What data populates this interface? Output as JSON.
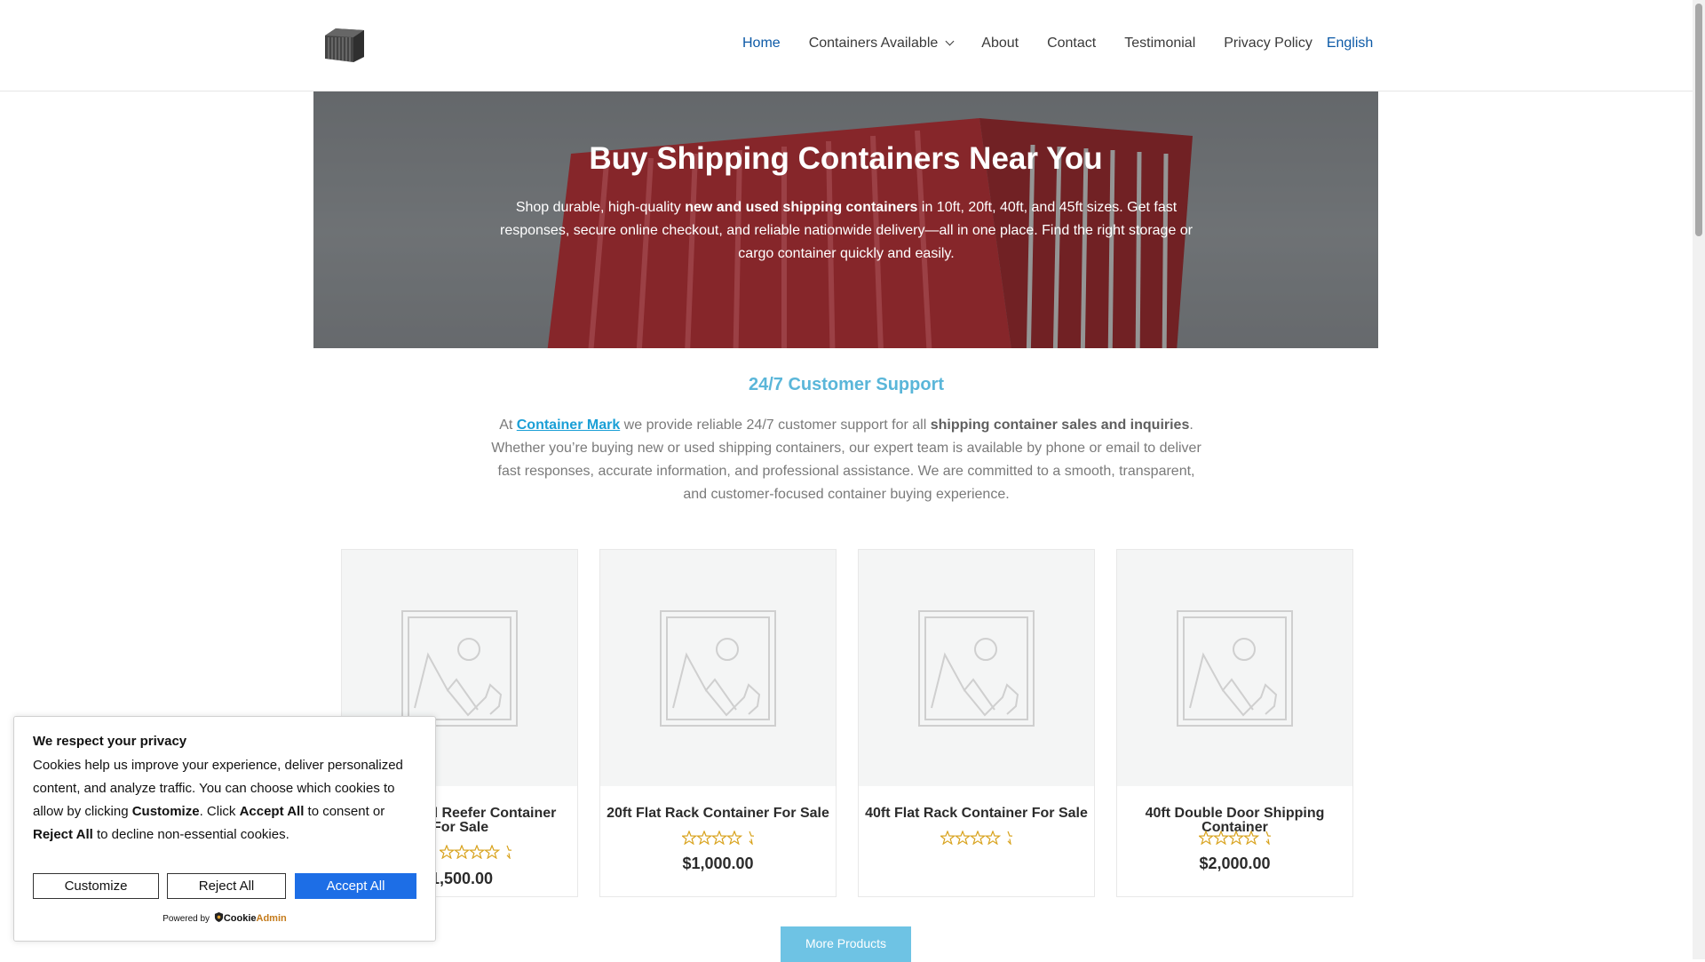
{
  "header": {
    "nav": [
      {
        "label": "Home"
      },
      {
        "label": "Containers Available"
      },
      {
        "label": "About"
      },
      {
        "label": "Contact"
      },
      {
        "label": "Testimonial"
      },
      {
        "label": "Privacy Policy"
      }
    ],
    "language": "English",
    "colors": {
      "active": "#0d5aa7"
    }
  },
  "hero": {
    "title": "Buy Shipping Containers Near You",
    "text_before": "Shop durable, high-quality ",
    "text_bold": "new and used shipping containers",
    "text_after": " in 10ft, 20ft, 40ft, and 45ft sizes. Get fast responses, secure online checkout, and reliable nationwide delivery—all in one place. Find the right storage or cargo container quickly and easily."
  },
  "support": {
    "title": "24/7 Customer Support",
    "pre": "At ",
    "link": "Container Mark",
    "mid": " we provide reliable 24/7 customer support for all ",
    "bold": "shipping container sales and inquiries",
    "post": ". Whether you’re buying new or used shipping containers, our expert team is available by phone or email to deliver fast responses, accurate information, and professional assistance. We are committed to a smooth, transparent, and customer-focused container buying experience.",
    "colors": {
      "title": "#5ab6d9",
      "link": "#1a9fd6"
    }
  },
  "products": [
    {
      "name": "ted Reefer Container",
      "name2": "For Sale",
      "price": "1,500.00",
      "rating": 4.5
    },
    {
      "name": "20ft Flat Rack Container For Sale",
      "price": "$1,000.00",
      "rating": 4.5
    },
    {
      "name": "40ft Flat Rack Container For Sale",
      "price": "",
      "rating": 4.5
    },
    {
      "name": "40ft Double Door Shipping Container",
      "price": "$2,000.00",
      "rating": 4.5
    }
  ],
  "more_products": "More Products",
  "cookie": {
    "title": "We respect your privacy",
    "t1": "Cookies help us improve your experience, deliver personalized content, and analyze traffic. You can choose which cookies to allow by clicking ",
    "b1": "Customize",
    "t2": ". Click ",
    "b2": "Accept All",
    "t3": " to consent or ",
    "b3": "Reject All",
    "t4": " to decline non-essential cookies.",
    "customize": "Customize",
    "reject": "Reject All",
    "accept": "Accept All",
    "powered_by": "Powered by",
    "brand1": "Cookie",
    "brand2": "Admin",
    "colors": {
      "accept": "#1d6ee6"
    }
  }
}
